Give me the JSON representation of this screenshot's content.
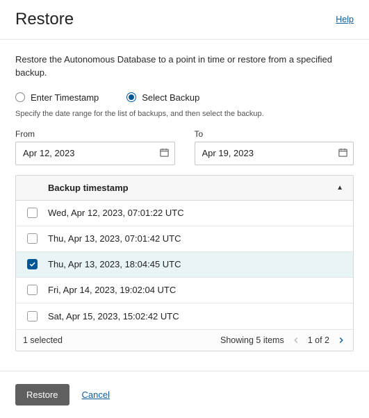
{
  "header": {
    "title": "Restore",
    "help": "Help"
  },
  "intro": "Restore the Autonomous Database to a point in time or restore from a specified backup.",
  "radios": {
    "enter_timestamp": "Enter Timestamp",
    "select_backup": "Select Backup",
    "selected": "select_backup"
  },
  "hint": "Specify the date range for the list of backups, and then select the backup.",
  "date_range": {
    "from_label": "From",
    "from_value": "Apr 12, 2023",
    "to_label": "To",
    "to_value": "Apr 19, 2023"
  },
  "table": {
    "header": "Backup timestamp",
    "sort_dir": "asc",
    "rows": [
      {
        "ts": "Wed, Apr 12, 2023, 07:01:22 UTC",
        "checked": false
      },
      {
        "ts": "Thu, Apr 13, 2023, 07:01:42 UTC",
        "checked": false
      },
      {
        "ts": "Thu, Apr 13, 2023, 18:04:45 UTC",
        "checked": true
      },
      {
        "ts": "Fri, Apr 14, 2023, 19:02:04 UTC",
        "checked": false
      },
      {
        "ts": "Sat, Apr 15, 2023, 15:02:42 UTC",
        "checked": false
      }
    ],
    "footer": {
      "selected_text": "1 selected",
      "showing": "Showing 5 items",
      "page_text": "1 of 2"
    }
  },
  "actions": {
    "restore": "Restore",
    "cancel": "Cancel"
  },
  "colors": {
    "accent": "#005693",
    "link": "#0a5c9e"
  }
}
